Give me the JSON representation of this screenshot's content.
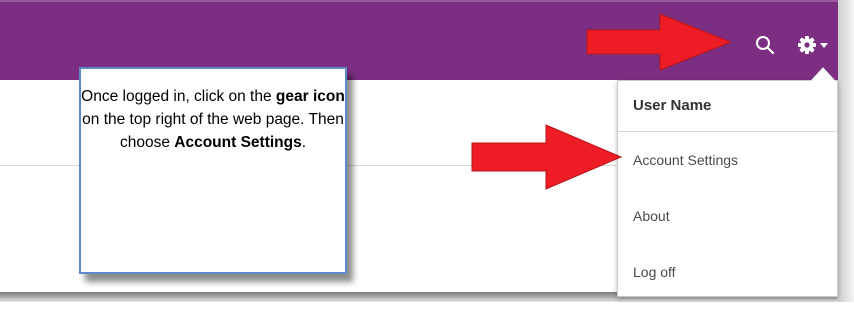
{
  "colors": {
    "topbar": "#7c2f82",
    "arrow": "#ee1c24",
    "callout_border": "#5b8ac6"
  },
  "header": {
    "search_icon": "search-icon",
    "settings_icon": "gear-icon",
    "settings_caret": "caret-down-icon"
  },
  "menu": {
    "header": "User Name",
    "items": [
      {
        "label": "Account Settings"
      },
      {
        "label": "About"
      },
      {
        "label": "Log off"
      }
    ]
  },
  "callout": {
    "line1_pre": "Once logged in, click on the",
    "line1_bold": "gear icon",
    "line1_post": "on the top right of the web page. Then choose",
    "line2_bold": "Account Settings",
    "line2_post": "."
  }
}
